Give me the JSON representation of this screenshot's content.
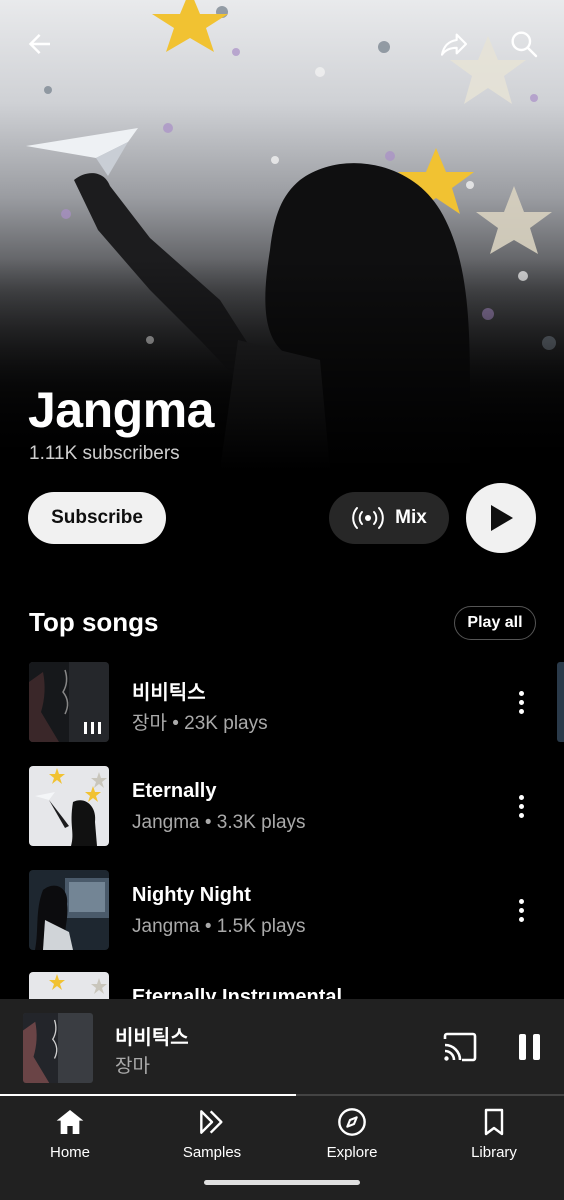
{
  "header": {
    "back_icon": "arrow-left-icon",
    "share_icon": "share-icon",
    "search_icon": "search-icon"
  },
  "artist": {
    "name": "Jangma",
    "subscribers": "1.11K subscribers"
  },
  "actions": {
    "subscribe_label": "Subscribe",
    "mix_label": "Mix",
    "mix_icon": "radio-waves-icon",
    "play_icon": "play-icon"
  },
  "top_songs": {
    "title": "Top songs",
    "play_all_label": "Play all",
    "songs": [
      {
        "title": "비비틱스",
        "subtitle": "장마 • 23K plays",
        "now_playing": true
      },
      {
        "title": "Eternally",
        "subtitle": "Jangma • 3.3K plays"
      },
      {
        "title": "Nighty Night",
        "subtitle": "Jangma • 1.5K plays"
      },
      {
        "title": "Eternally Instrumental",
        "subtitle": ""
      }
    ]
  },
  "mini_player": {
    "title": "비비틱스",
    "artist": "장마",
    "cast_icon": "cast-icon",
    "pause_icon": "pause-icon",
    "progress": 0.525
  },
  "nav": {
    "items": [
      {
        "label": "Home",
        "icon": "home-icon"
      },
      {
        "label": "Samples",
        "icon": "samples-icon"
      },
      {
        "label": "Explore",
        "icon": "compass-icon"
      },
      {
        "label": "Library",
        "icon": "bookmark-icon"
      }
    ]
  },
  "colors": {
    "background": "#000000",
    "surface": "#212121",
    "chip": "#272727",
    "light_button": "#f1f1f1",
    "secondary_text": "#aaaaaa"
  }
}
